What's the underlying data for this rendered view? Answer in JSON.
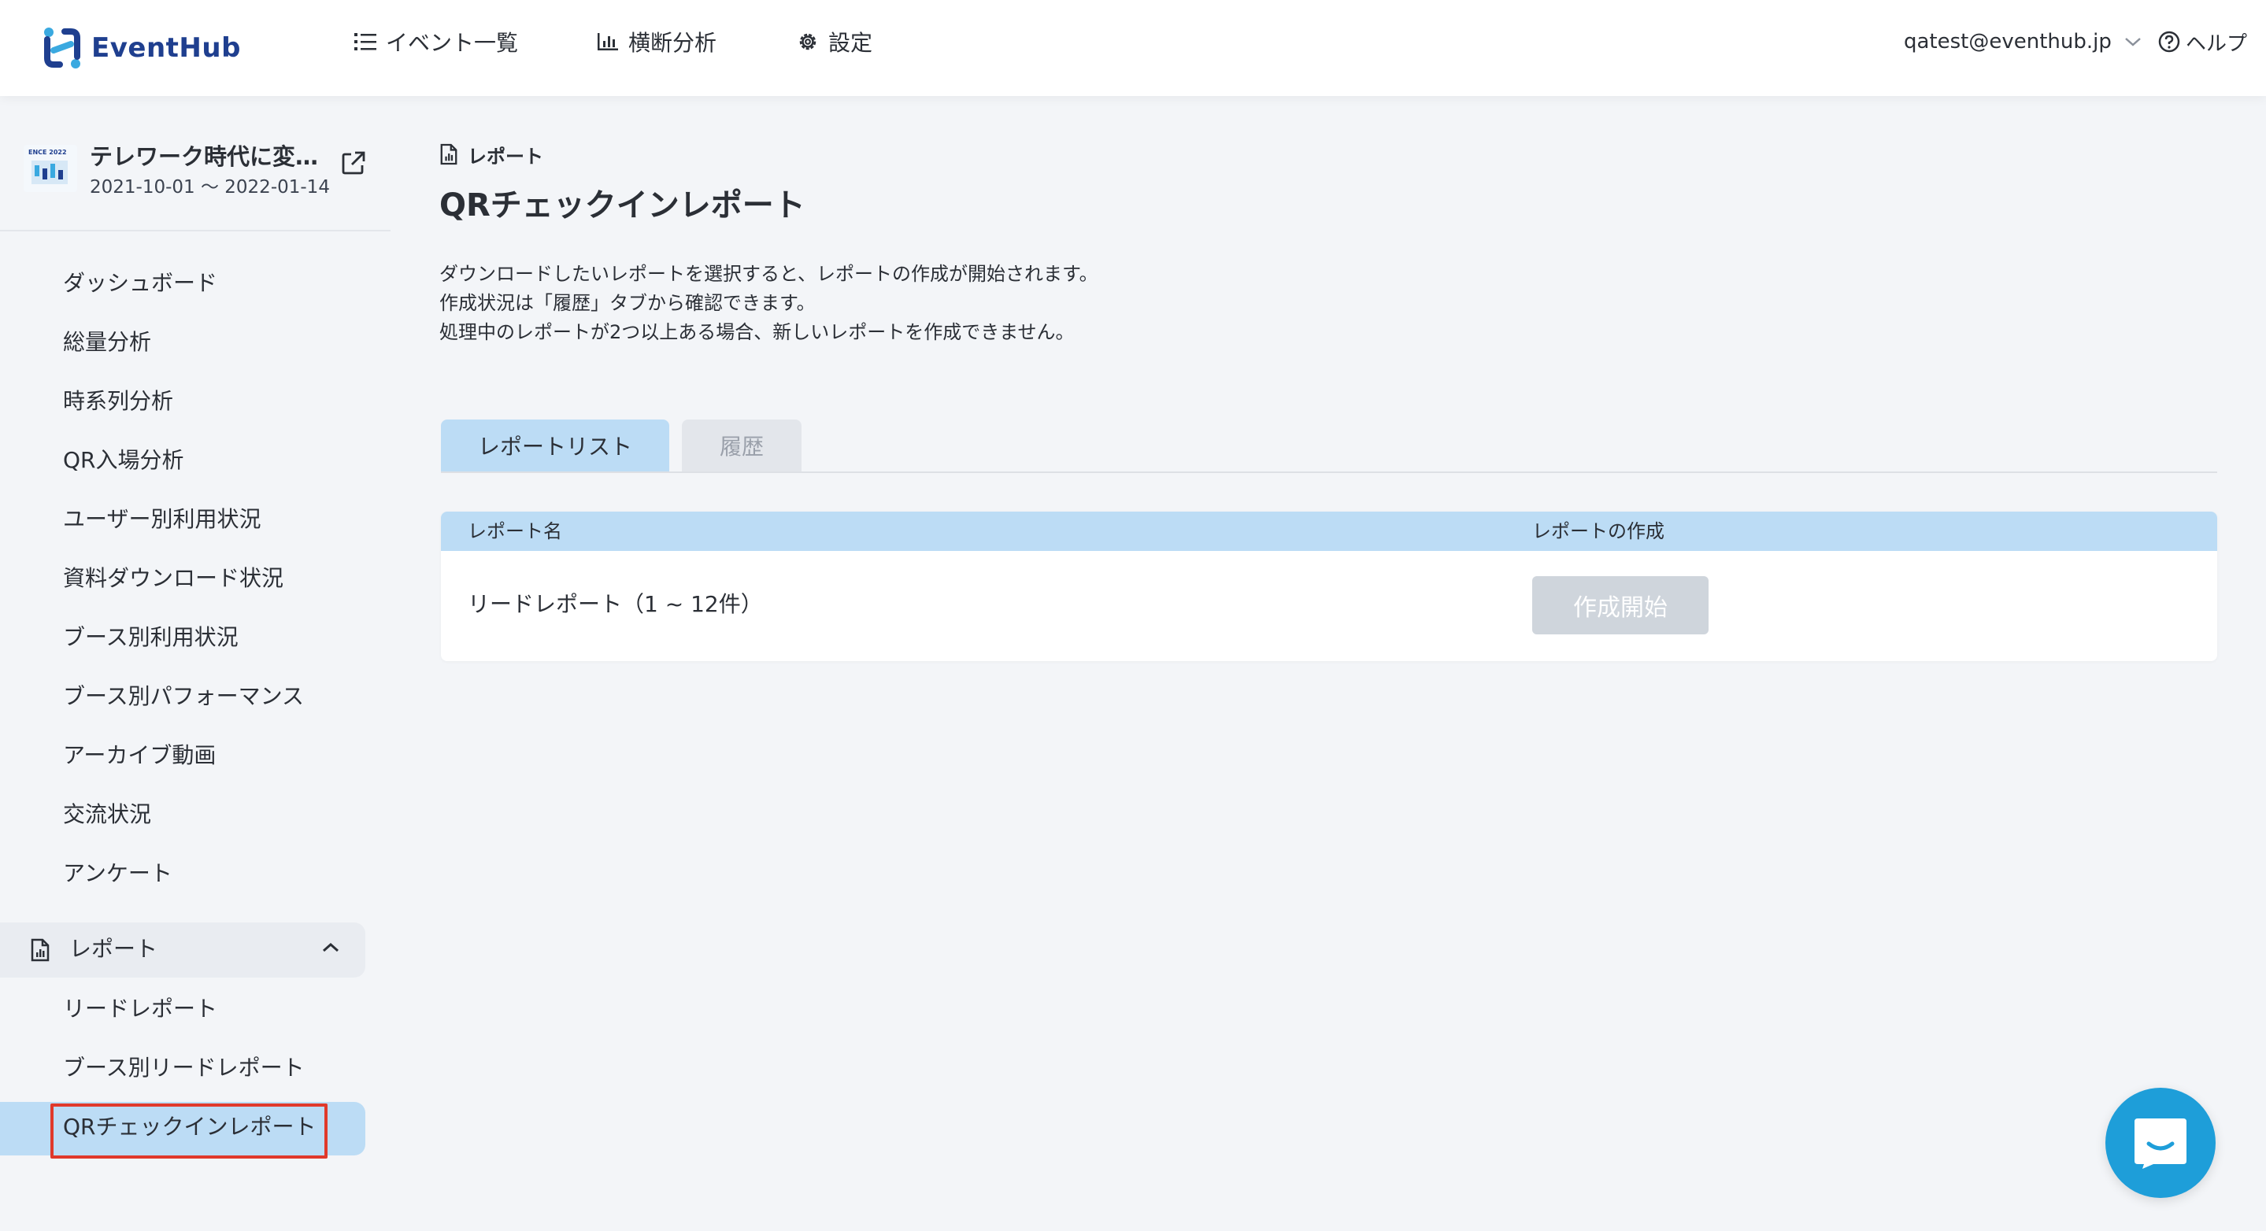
{
  "app": {
    "logo_text": "EventHub",
    "brand_color": "#1f3f8f",
    "accent_color": "#1e9ed9"
  },
  "header": {
    "nav": {
      "events": "イベント一覧",
      "analysis": "横断分析",
      "settings": "設定"
    },
    "user_email": "qatest@eventhub.jp",
    "help": "ヘルプ"
  },
  "event": {
    "title": "テレワーク時代に変…",
    "dates": "2021-10-01 ～ 2022-01-14",
    "thumb_text": "ENCE 2022"
  },
  "sidebar": {
    "items": [
      "ダッシュボード",
      "総量分析",
      "時系列分析",
      "QR入場分析",
      "ユーザー別利用状況",
      "資料ダウンロード状況",
      "ブース別利用状況",
      "ブース別パフォーマンス",
      "アーカイブ動画",
      "交流状況",
      "アンケート"
    ],
    "report_section": "レポート",
    "report_items": [
      "リードレポート",
      "ブース別リードレポート",
      "QRチェックインレポート"
    ]
  },
  "main": {
    "breadcrumb": "レポート",
    "title": "QRチェックインレポート",
    "description": [
      "ダウンロードしたいレポートを選択すると、レポートの作成が開始されます。",
      "作成状況は「履歴」タブから確認できます。",
      "処理中のレポートが2つ以上ある場合、新しいレポートを作成できません。"
    ],
    "tabs": {
      "report_list": "レポートリスト",
      "history": "履歴"
    },
    "table": {
      "col_name": "レポート名",
      "col_create": "レポートの作成",
      "rows": [
        {
          "name": "リードレポート（1 ~ 12件）",
          "action": "作成開始"
        }
      ]
    }
  }
}
